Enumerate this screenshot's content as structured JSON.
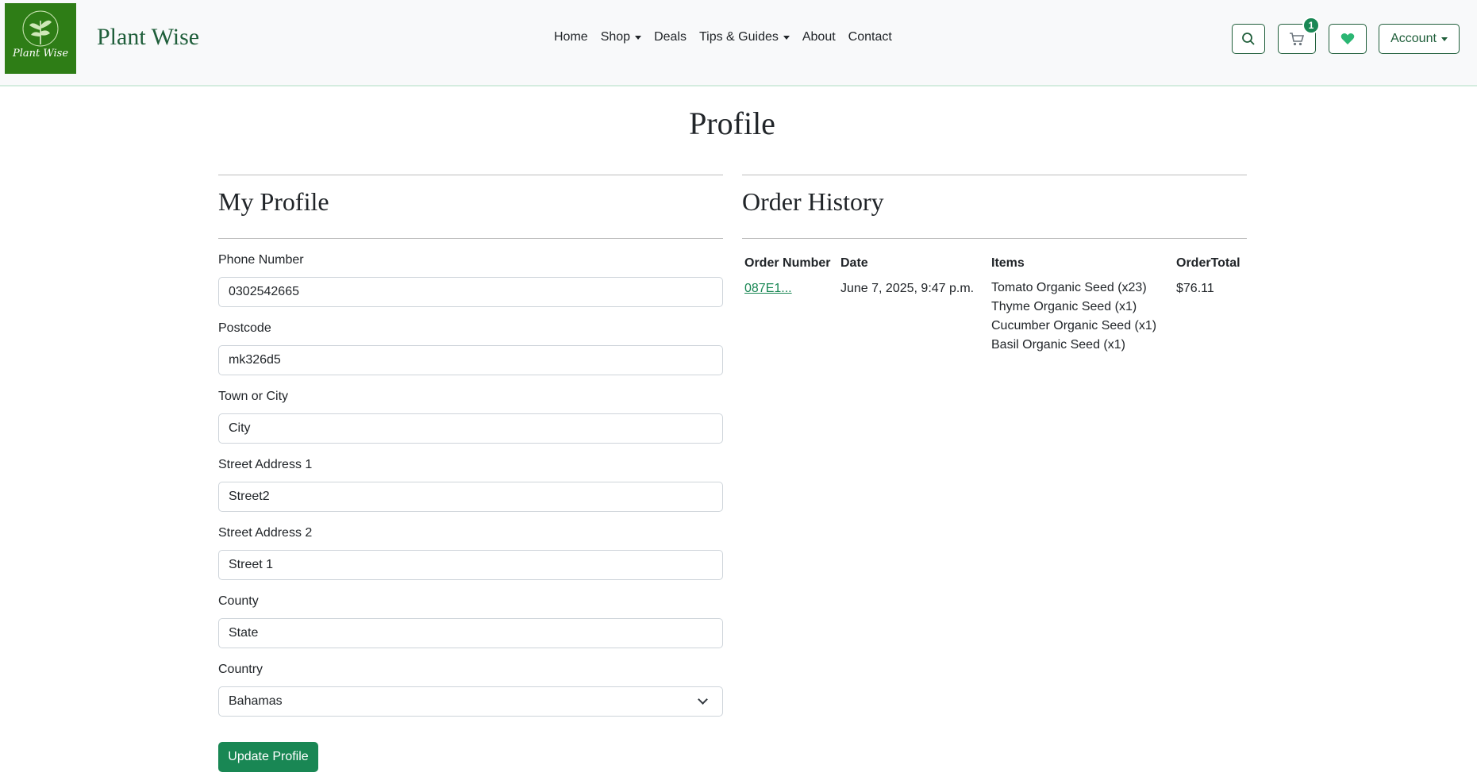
{
  "brand": {
    "name": "Plant Wise",
    "logo_text": "Plant Wise"
  },
  "nav": {
    "items": [
      {
        "label": "Home",
        "dropdown": false
      },
      {
        "label": "Shop",
        "dropdown": true
      },
      {
        "label": "Deals",
        "dropdown": false
      },
      {
        "label": "Tips & Guides",
        "dropdown": true
      },
      {
        "label": "About",
        "dropdown": false
      },
      {
        "label": "Contact",
        "dropdown": false
      }
    ]
  },
  "header_actions": {
    "cart_count": "1",
    "account_label": "Account",
    "icons": [
      "search-icon",
      "cart-icon",
      "heart-icon"
    ]
  },
  "page": {
    "title": "Profile"
  },
  "profile": {
    "heading": "My Profile",
    "fields": {
      "phone": {
        "label": "Phone Number",
        "value": "0302542665"
      },
      "postcode": {
        "label": "Postcode",
        "value": "mk326d5"
      },
      "town": {
        "label": "Town or City",
        "value": "City"
      },
      "street1": {
        "label": "Street Address 1",
        "value": "Street2"
      },
      "street2": {
        "label": "Street Address 2",
        "value": "Street 1"
      },
      "county": {
        "label": "County",
        "value": "State"
      },
      "country": {
        "label": "Country",
        "value": "Bahamas"
      }
    },
    "submit_label": "Update Profile"
  },
  "orders": {
    "heading": "Order History",
    "columns": [
      "Order Number",
      "Date",
      "Items",
      "OrderTotal"
    ],
    "rows": [
      {
        "number": "087E1...",
        "date": "June 7, 2025, 9:47 p.m.",
        "items": [
          "Tomato Organic Seed (x23)",
          "Thyme Organic Seed (x1)",
          "Cucumber Organic Seed (x1)",
          "Basil Organic Seed (x1)"
        ],
        "total": "$76.11"
      }
    ]
  },
  "colors": {
    "brand_green": "#1f5e3a",
    "button_green": "#198754",
    "logo_bg": "#2e7d16"
  }
}
